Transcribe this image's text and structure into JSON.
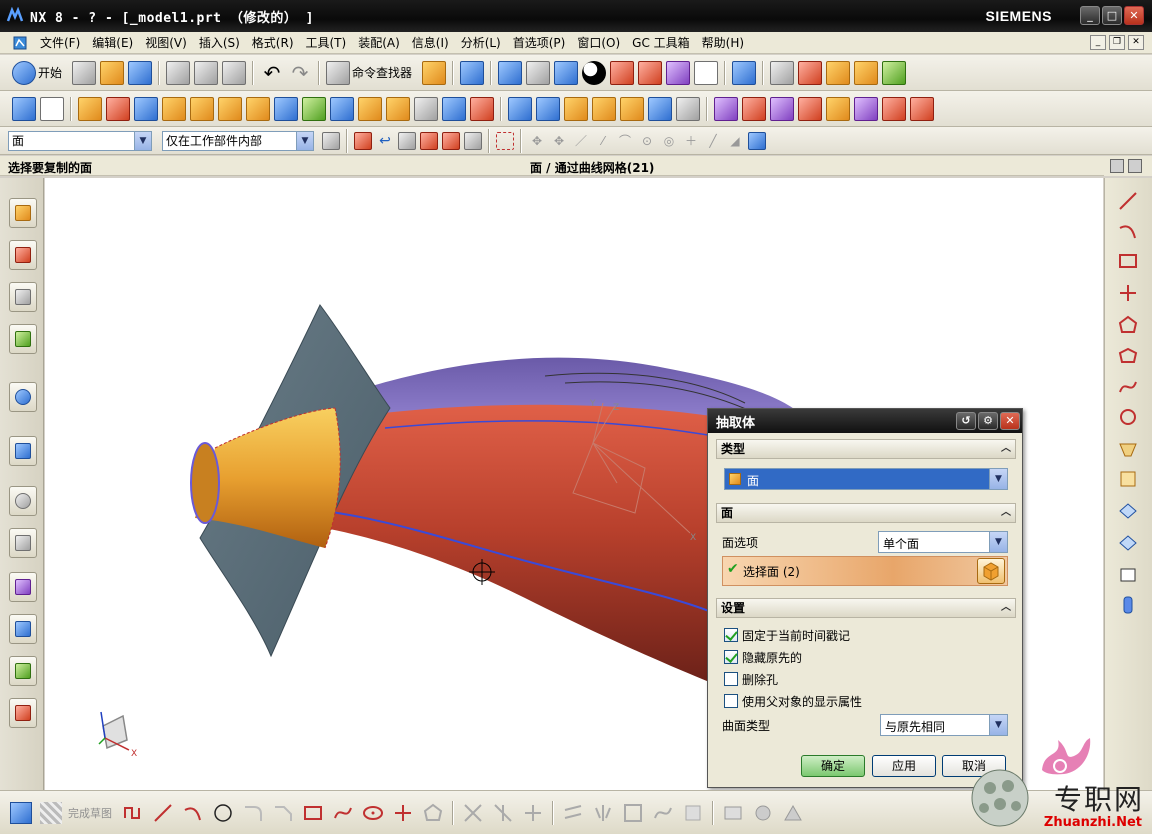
{
  "window": {
    "title": "NX 8 - ? - [_model1.prt （修改的） ]",
    "brand": "SIEMENS",
    "controls": [
      "_",
      "□",
      "✕"
    ]
  },
  "menubar": {
    "items": [
      "文件(F)",
      "编辑(E)",
      "视图(V)",
      "插入(S)",
      "格式(R)",
      "工具(T)",
      "装配(A)",
      "信息(I)",
      "分析(L)",
      "首选项(P)",
      "窗口(O)",
      "GC 工具箱",
      "帮助(H)"
    ]
  },
  "toolbar_standard": {
    "start_label": "开始",
    "command_finder_label": "命令查找器"
  },
  "selection_bar": {
    "filter_value": "面",
    "scope_value": "仅在工作部件内部"
  },
  "cue_line": {
    "prompt": "选择要复制的面",
    "status": "面 / 通过曲线网格(21)"
  },
  "graphics": {
    "triad_labels": {
      "x": "X",
      "y": "Y",
      "z": "Z"
    }
  },
  "dialog": {
    "title": "抽取体",
    "sections": {
      "type": "类型",
      "face": "面",
      "settings": "设置"
    },
    "type_value": "面",
    "face_option_label": "面选项",
    "face_option_value": "单个面",
    "select_face_label": "选择面 (2)",
    "checkboxes": [
      {
        "label": "固定于当前时间戳记",
        "checked": true
      },
      {
        "label": "隐藏原先的",
        "checked": true
      },
      {
        "label": "删除孔",
        "checked": false
      },
      {
        "label": "使用父对象的显示属性",
        "checked": false
      }
    ],
    "surface_type_label": "曲面类型",
    "surface_type_value": "与原先相同",
    "buttons": {
      "ok": "确定",
      "apply": "应用",
      "cancel": "取消"
    }
  },
  "bottom_toolbar": {
    "finish_sketch_label": "完成草图"
  },
  "watermark": {
    "text": "专职网",
    "url": "Zhuanzhi.Net"
  },
  "colors": {
    "titlebar": "#111111",
    "body_red": "#b8402c",
    "body_purple": "#8a7ac8",
    "sheet_gray": "#5a6d78",
    "cone_orange": "#e8a030",
    "curve_blue": "#3a4ad8",
    "dialog_bg": "#ece9d8"
  }
}
